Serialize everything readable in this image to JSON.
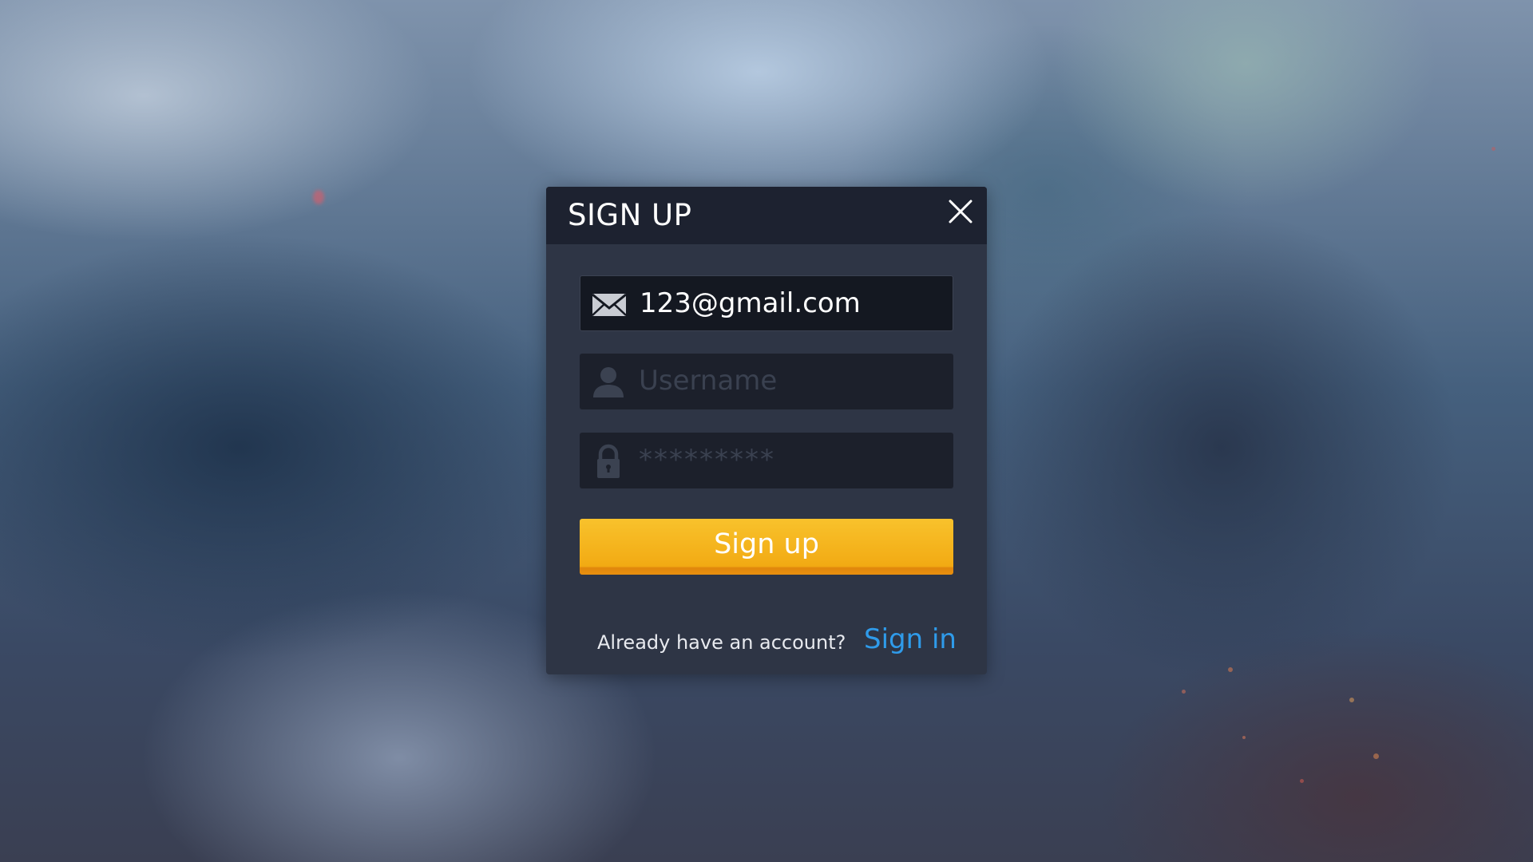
{
  "dialog": {
    "title": "SIGN UP",
    "close_icon": "close-icon"
  },
  "form": {
    "email": {
      "icon": "envelope-icon",
      "value": "123@gmail.com"
    },
    "username": {
      "icon": "user-icon",
      "placeholder": "Username"
    },
    "password": {
      "icon": "lock-icon",
      "placeholder": "*********"
    },
    "submit_label": "Sign up"
  },
  "footer": {
    "prompt": "Already have an account?",
    "link_label": "Sign in"
  },
  "colors": {
    "accent": "#f4b41e",
    "link": "#2f9bea",
    "dialog_bg": "#2e3545",
    "header_bg": "#1d2230"
  }
}
